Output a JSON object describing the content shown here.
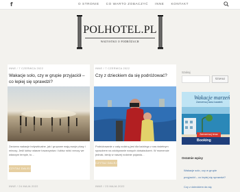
{
  "topbar": {
    "facebook_glyph": "f",
    "nav": [
      "O STRONIE",
      "CO WARTO ZOBACZYĆ",
      "INNE",
      "KONTAKT"
    ]
  },
  "logo": {
    "title": "POLHOTEL.PL",
    "tagline": "WSZYSTKO O PODRÓŻACH"
  },
  "posts": [
    {
      "meta": "INNE  /  7 CZERWCA 2022",
      "title": "Wakacje solo, czy w grupie przyjaciół – co lepiej się sprawdzi?",
      "excerpt": "Zarówno wakacje indywidualne, jak i grupowe mają swoje plusy i minusy. Jeśli lubisz własne towarzystwo i lubisz robić rzeczy we własnym tempie, to…",
      "button": "CZYTAJ DALEJ"
    },
    {
      "meta": "INNE  /  7 CZERWCA 2022",
      "title": "Czy z dzieckiem da się podróżować?",
      "excerpt": "Podróżowanie z całą rodziną jest dla każdego z nas świetnym sposobem na zdobywanie nowych doświadczeń. W momencie jednak, kiedy w naszej rodzinie pojawia…",
      "button": "CZYTAJ DALEJ"
    }
  ],
  "bottom_meta": [
    "INNE  /  24 MAJA 2022",
    "INNE  /  23 MAJA 2022"
  ],
  "sidebar": {
    "search_label": "Szukaj",
    "search_button": "SZUKAJ",
    "ad_title": "Wakacje marzeń",
    "ad_subtitle": "Zarezerwuj wasz kawałek",
    "ad_cta": "Zarezerwuj teraz",
    "ad_brand": "Booking",
    "recent_heading": "Ostatnie wpisy",
    "recent": [
      "Wakacje solo, czy w grupie",
      "przyjaciół – co lepiej się sprawdzi?",
      "Czy z dzieckiem da się"
    ]
  },
  "colors": {
    "accent": "#e6cfa1",
    "background": "#f3f2ee",
    "link": "#3d6fa8"
  }
}
